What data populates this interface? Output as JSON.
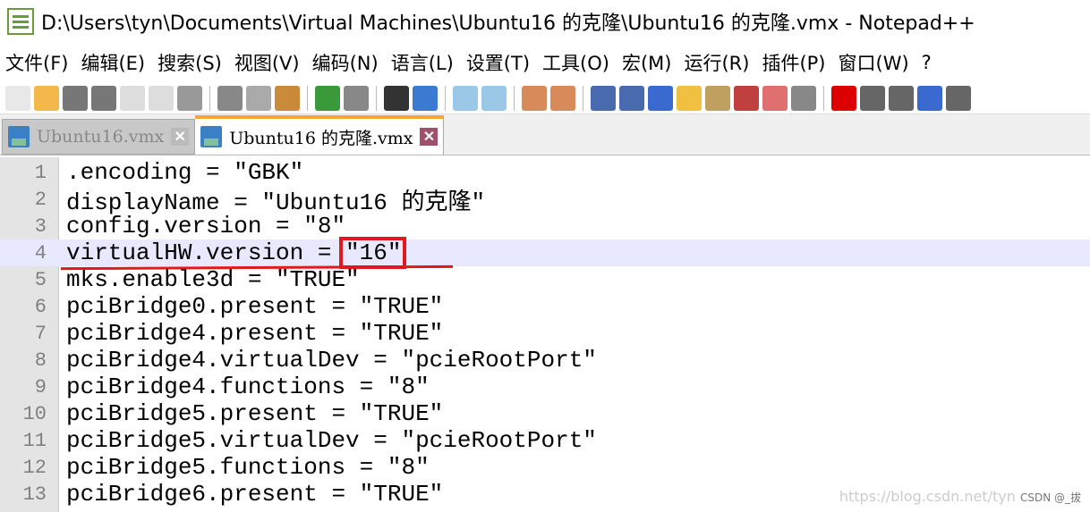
{
  "window": {
    "title": "D:\\Users\\tyn\\Documents\\Virtual Machines\\Ubuntu16 的克隆\\Ubuntu16 的克隆.vmx - Notepad++"
  },
  "menu": [
    "文件(F)",
    "编辑(E)",
    "搜索(S)",
    "视图(V)",
    "编码(N)",
    "语言(L)",
    "设置(T)",
    "工具(O)",
    "宏(M)",
    "运行(R)",
    "插件(P)",
    "窗口(W)",
    "?"
  ],
  "toolbar": [
    {
      "name": "new-file-icon",
      "color": "#e8e8e8"
    },
    {
      "name": "open-file-icon",
      "color": "#f2b84b"
    },
    {
      "name": "save-icon",
      "color": "#777"
    },
    {
      "name": "save-all-icon",
      "color": "#777"
    },
    {
      "name": "close-icon",
      "color": "#ddd"
    },
    {
      "name": "close-all-icon",
      "color": "#ddd"
    },
    {
      "name": "print-icon",
      "color": "#999"
    },
    "sep",
    {
      "name": "cut-icon",
      "color": "#888"
    },
    {
      "name": "copy-icon",
      "color": "#aaa"
    },
    {
      "name": "paste-icon",
      "color": "#c98a3a"
    },
    "sep",
    {
      "name": "undo-icon",
      "color": "#3a9a3a"
    },
    {
      "name": "redo-icon",
      "color": "#888"
    },
    "sep",
    {
      "name": "find-icon",
      "color": "#333"
    },
    {
      "name": "replace-icon",
      "color": "#3a7ad0"
    },
    "sep",
    {
      "name": "zoom-in-icon",
      "color": "#9cc8e8"
    },
    {
      "name": "zoom-out-icon",
      "color": "#9cc8e8"
    },
    "sep",
    {
      "name": "sync-vertical-icon",
      "color": "#d88a5a"
    },
    {
      "name": "sync-horizontal-icon",
      "color": "#d88a5a"
    },
    "sep",
    {
      "name": "word-wrap-icon",
      "color": "#4a6ab0"
    },
    {
      "name": "show-all-chars-icon",
      "color": "#4a6ab0"
    },
    {
      "name": "indent-guide-icon",
      "color": "#3a6ad0"
    },
    {
      "name": "user-language-icon",
      "color": "#f0c040"
    },
    {
      "name": "doc-map-icon",
      "color": "#c0a060"
    },
    {
      "name": "function-list-icon",
      "color": "#c04040"
    },
    {
      "name": "folder-workspace-icon",
      "color": "#e07070"
    },
    {
      "name": "monitoring-icon",
      "color": "#888"
    },
    "sep",
    {
      "name": "record-macro-icon",
      "color": "#d00"
    },
    {
      "name": "stop-macro-icon",
      "color": "#666"
    },
    {
      "name": "play-macro-icon",
      "color": "#666"
    },
    {
      "name": "play-macro-multiple-icon",
      "color": "#3a6ad0"
    },
    {
      "name": "save-macro-icon",
      "color": "#666"
    }
  ],
  "tabs": [
    {
      "label": "Ubuntu16.vmx",
      "active": false
    },
    {
      "label": "Ubuntu16 的克隆.vmx",
      "active": true
    }
  ],
  "editor": {
    "current_line": 4,
    "lines": [
      ".encoding = \"GBK\"",
      "displayName = \"Ubuntu16 的克隆\"",
      "config.version = \"8\"",
      "virtualHW.version = \"16\"",
      "mks.enable3d = \"TRUE\"",
      "pciBridge0.present = \"TRUE\"",
      "pciBridge4.present = \"TRUE\"",
      "pciBridge4.virtualDev = \"pcieRootPort\"",
      "pciBridge4.functions = \"8\"",
      "pciBridge5.present = \"TRUE\"",
      "pciBridge5.virtualDev = \"pcieRootPort\"",
      "pciBridge5.functions = \"8\"",
      "pciBridge6.present = \"TRUE\""
    ]
  },
  "watermark": {
    "url": "https://blog.csdn.net/tyn",
    "credit": "CSDN @_拔"
  }
}
